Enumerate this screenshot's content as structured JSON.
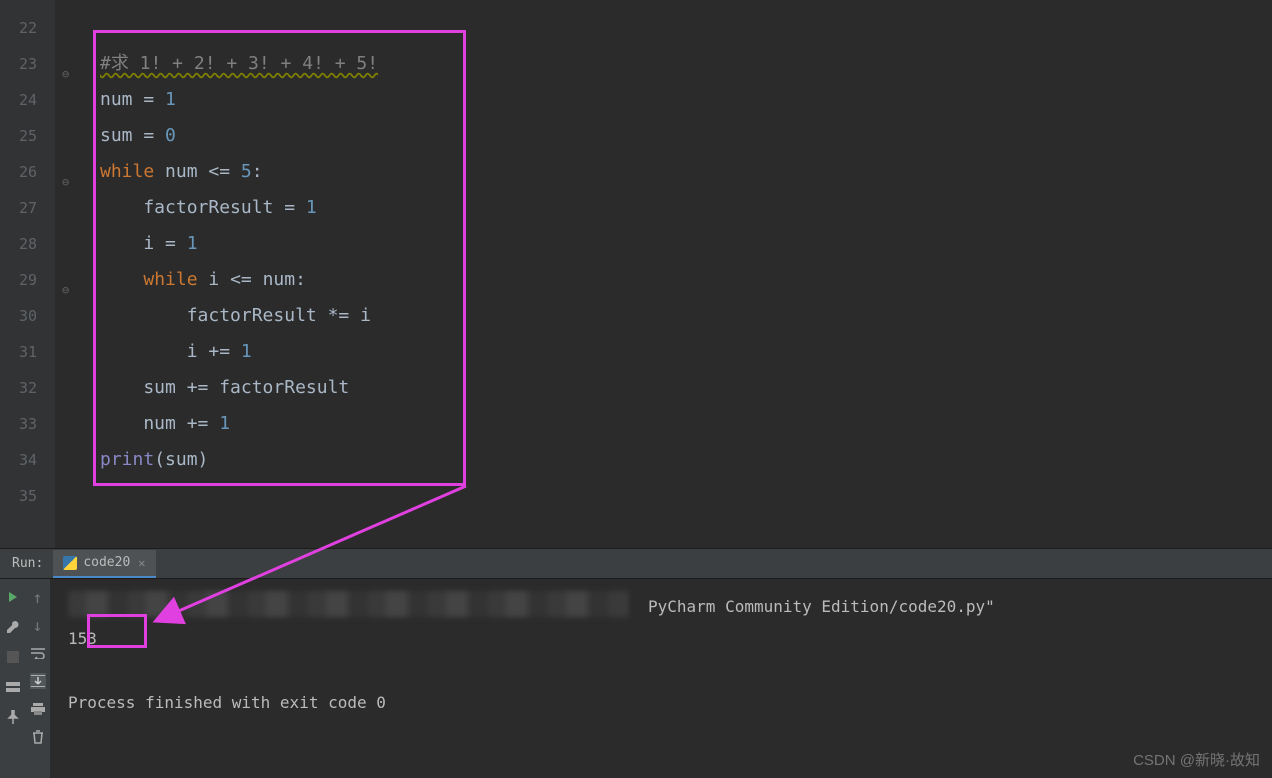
{
  "editor": {
    "line_numbers": [
      "22",
      "23",
      "24",
      "25",
      "26",
      "27",
      "28",
      "29",
      "30",
      "31",
      "32",
      "33",
      "34",
      "35"
    ],
    "lines": {
      "l23_comment": "#求 1! + 2! + 3! + 4! + 5!",
      "l24_a": "num = ",
      "l24_n": "1",
      "l25_a": "sum = ",
      "l25_n": "0",
      "l26_kw": "while ",
      "l26_rest": "num <= ",
      "l26_n": "5",
      "l26_colon": ":",
      "l27_a": "    factorResult = ",
      "l27_n": "1",
      "l28_a": "    i = ",
      "l28_n": "1",
      "l29_pre": "    ",
      "l29_kw": "while ",
      "l29_rest": "i <= num:",
      "l30_a": "        factorResult *= i",
      "l31_a": "        i += ",
      "l31_n": "1",
      "l32_a": "    sum += factorResult",
      "l33_a": "    num += ",
      "l33_n": "1",
      "l34_fn": "print",
      "l34_rest": "(sum)"
    }
  },
  "run": {
    "label": "Run:",
    "tab_name": "code20",
    "path_text": "PyCharm Community Edition/code20.py\"",
    "output_value": "153",
    "exit_line": "Process finished with exit code 0"
  },
  "watermark": "CSDN @新晓·故知"
}
